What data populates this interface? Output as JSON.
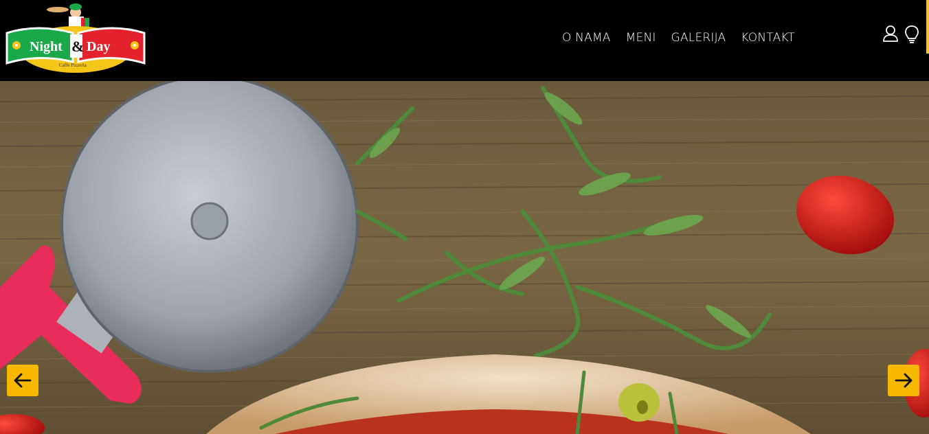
{
  "brand": {
    "logo_text_left": "Night",
    "logo_amp": "&",
    "logo_text_right": "Day",
    "logo_sub": "Caffe Pizzeria"
  },
  "nav": {
    "items": [
      {
        "label": "O NAMA"
      },
      {
        "label": "MENI"
      },
      {
        "label": "GALERIJA"
      },
      {
        "label": "KONTAKT"
      }
    ]
  },
  "header_icons": [
    "user-icon",
    "lightbulb-icon"
  ],
  "slider": {
    "prev_icon": "arrow-left-icon",
    "next_icon": "arrow-right-icon"
  },
  "colors": {
    "header_bg": "#000000",
    "accent": "#f6b800",
    "logo_green": "#1aa84a",
    "logo_red": "#e3222d",
    "logo_yellow": "#f5c518"
  }
}
